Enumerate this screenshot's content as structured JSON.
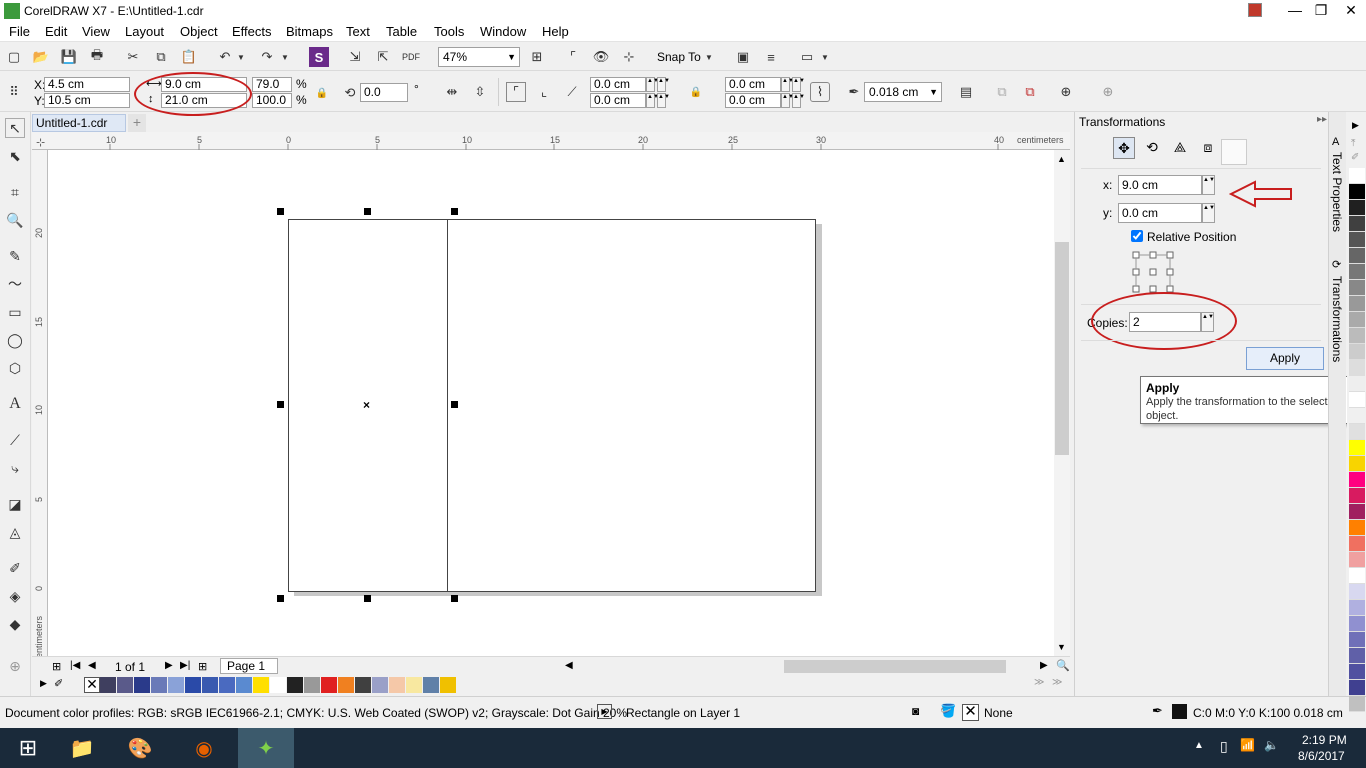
{
  "window": {
    "title": "CorelDRAW X7 - E:\\Untitled-1.cdr",
    "controls": [
      "—",
      "❐",
      "✕"
    ]
  },
  "menu": [
    "File",
    "Edit",
    "View",
    "Layout",
    "Object",
    "Effects",
    "Bitmaps",
    "Text",
    "Table",
    "Tools",
    "Window",
    "Help"
  ],
  "standard_toolbar": {
    "zoom": "47%",
    "snap_to": "Snap To"
  },
  "property_bar": {
    "x": "4.5 cm",
    "y": "10.5 cm",
    "width": "9.0 cm",
    "height": "21.0 cm",
    "scale_w": "79.0",
    "scale_h": "100.0",
    "percent": "%",
    "rotation": "0.0",
    "degree": "°",
    "corner1": "0.0 cm",
    "corner2": "0.0 cm",
    "corner3": "0.0 cm",
    "corner4": "0.0 cm",
    "outline_width": "0.018 cm"
  },
  "document": {
    "tab": "Untitled-1.cdr",
    "h_ruler_ticks": [
      "10",
      "5",
      "0",
      "5",
      "10",
      "15",
      "20",
      "25",
      "30",
      "40"
    ],
    "h_ruler_unit": "centimeters",
    "v_ruler_ticks": [
      "20",
      "15",
      "10",
      "5",
      "0"
    ],
    "v_ruler_unit": "centimeters",
    "page_counter": "1 of 1",
    "page_tab": "Page 1"
  },
  "docker": {
    "title": "Transformations",
    "x_label": "x:",
    "x_value": "9.0 cm",
    "y_label": "y:",
    "y_value": "0.0 cm",
    "relative_position_label": "Relative Position",
    "relative_position_checked": true,
    "copies_label": "Copies:",
    "copies_value": "2",
    "apply_label": "Apply",
    "tabs": [
      "Text Properties",
      "Transformations"
    ]
  },
  "tooltip": {
    "title": "Apply",
    "text": "Apply the transformation to the selected object."
  },
  "status": {
    "color_profiles": "Document color profiles: RGB: sRGB IEC61966-2.1; CMYK: U.S. Web Coated (SWOP) v2; Grayscale: Dot Gain 20%",
    "selection": "Rectangle on Layer 1",
    "fill": "None",
    "outline": "C:0 M:0 Y:0 K:100  0.018 cm"
  },
  "taskbar": {
    "time": "2:19 PM",
    "date": "8/6/2017"
  },
  "colors": {
    "annotation": "#c81e1e",
    "doc_palette": [
      "#3f3f5f",
      "#5a5a8a",
      "#2a3a8a",
      "#6a7ab8",
      "#8aa2d8",
      "#2a4aa8",
      "#3a5ab0",
      "#4a6ac0",
      "#5a8ad0",
      "#ffdf00",
      "#ffffff",
      "#222222",
      "#999999",
      "#e02020",
      "#f08020",
      "#404040",
      "#9aa0c8",
      "#f5c8a8",
      "#f8e8a0",
      "#6080a8",
      "#f0c000"
    ],
    "side_palette": [
      "#ffffff",
      "#000000",
      "#202020",
      "#404040",
      "#555555",
      "#666666",
      "#777777",
      "#888888",
      "#999999",
      "#aaaaaa",
      "#bbbbbb",
      "#cccccc",
      "#dddddd",
      "#eeeeee",
      "#ffffff",
      "#f0f0f0",
      "#e0e0e0",
      "#ffff00",
      "#f8d400",
      "#ff0080",
      "#d81b60",
      "#a02060",
      "#ff8000",
      "#f07060",
      "#f0a0a0",
      "#ffffff",
      "#d8d8f0",
      "#b0b0e0",
      "#9090d0",
      "#7070b8",
      "#6060a8",
      "#5050a0",
      "#404090",
      "#c0c0c0"
    ]
  }
}
